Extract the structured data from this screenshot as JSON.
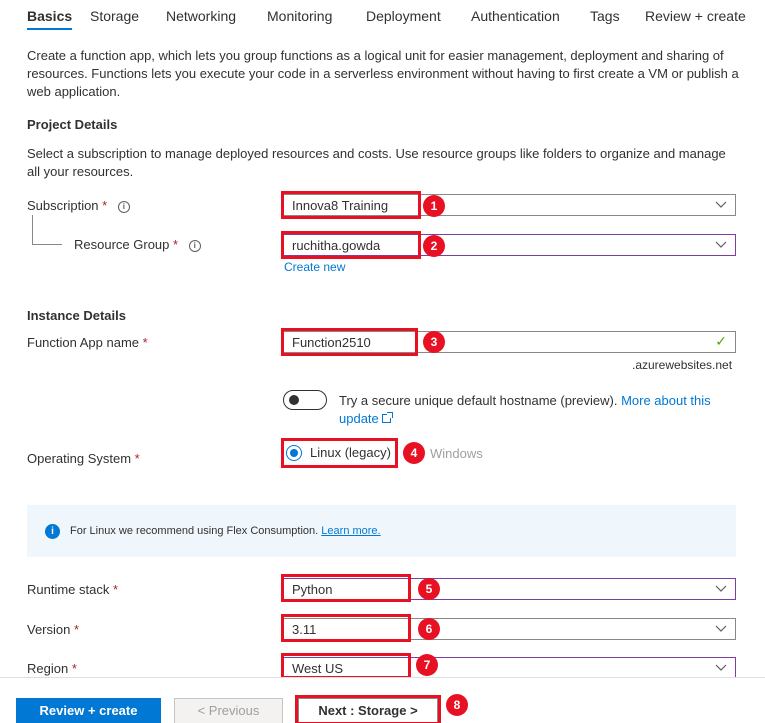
{
  "tabs": [
    {
      "label": "Basics",
      "active": true
    },
    {
      "label": "Storage"
    },
    {
      "label": "Networking"
    },
    {
      "label": "Monitoring"
    },
    {
      "label": "Deployment"
    },
    {
      "label": "Authentication"
    },
    {
      "label": "Tags"
    },
    {
      "label": "Review + create"
    }
  ],
  "intro": "Create a function app, which lets you group functions as a logical unit for easier management, deployment and sharing of resources. Functions lets you execute your code in a serverless environment without having to first create a VM or publish a web application.",
  "project_details": {
    "heading": "Project Details",
    "description": "Select a subscription to manage deployed resources and costs. Use resource groups like folders to organize and manage all your resources.",
    "subscription": {
      "label": "Subscription",
      "required": "*",
      "info": "i",
      "value": "Innova8 Training",
      "step": "1"
    },
    "resource_group": {
      "label": "Resource Group",
      "required": "*",
      "info": "i",
      "value": "ruchitha.gowda",
      "step": "2",
      "create_new": "Create new"
    }
  },
  "instance_details": {
    "heading": "Instance Details",
    "function_app_name": {
      "label": "Function App name",
      "required": "*",
      "value": "Function2510",
      "step": "3",
      "check": "✓",
      "suffix": ".azurewebsites.net"
    },
    "hostname_toggle": {
      "text": "Try a secure unique default hostname (preview).",
      "link": "More about this update",
      "on": false
    },
    "operating_system": {
      "label": "Operating System",
      "required": "*",
      "option_linux": "Linux (legacy)",
      "option_windows": "Windows",
      "selected": "Linux (legacy)",
      "step": "4"
    }
  },
  "infobar": {
    "icon": "i",
    "text": "For Linux we recommend using Flex Consumption.",
    "link": "Learn more."
  },
  "runtime_stack": {
    "label": "Runtime stack",
    "required": "*",
    "value": "Python",
    "step": "5"
  },
  "version": {
    "label": "Version",
    "required": "*",
    "value": "3.11",
    "step": "6"
  },
  "region": {
    "label": "Region",
    "required": "*",
    "value": "West US",
    "step": "7"
  },
  "footer": {
    "review_create": "Review + create",
    "previous": "< Previous",
    "next": "Next : Storage >",
    "step": "8"
  },
  "colors": {
    "accent": "#0078d4",
    "highlight": "#e81123",
    "required": "#a4262c",
    "success": "#57a300"
  }
}
